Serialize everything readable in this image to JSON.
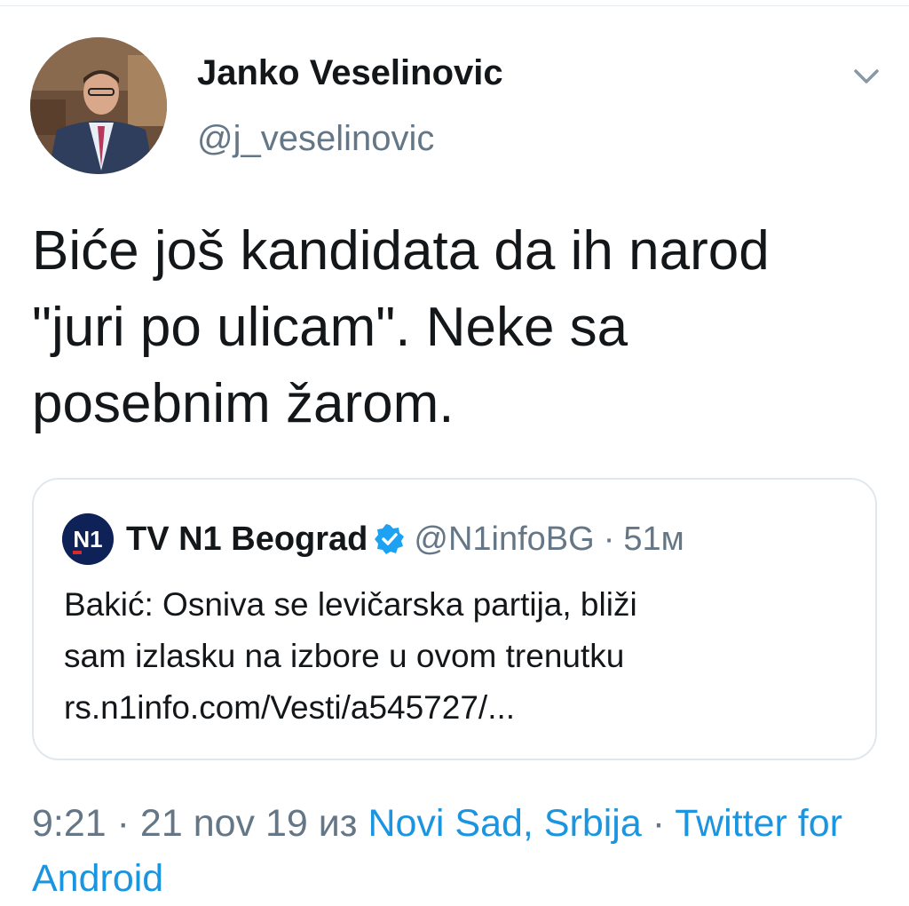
{
  "author": {
    "display_name": "Janko Veselinovic",
    "handle": "@j_veselinovic"
  },
  "tweet": {
    "text": "Biće još kandidata da ih narod\n\"juri po ulicam\". Neke sa\nposebnim žarom."
  },
  "quoted_tweet": {
    "logo_text": "N1",
    "name": "TV N1 Beograd",
    "handle": "@N1infoBG",
    "separator": "·",
    "time": "51м",
    "text_line1": "Bakić: Osniva se levičarska partija, bliži",
    "text_line2": "sam izlasku na izbore u ovom trenutku",
    "link": "rs.n1info.com/Vesti/a545727/..."
  },
  "meta": {
    "time": "9:21",
    "sep1": " · ",
    "date": "21 nov 19",
    "from_word": " из ",
    "location": "Novi Sad, Srbija",
    "sep2": " · ",
    "client": "Twitter for Android"
  },
  "colors": {
    "link": "#1b95e0",
    "secondary_text": "#657786",
    "primary_text": "#14171a",
    "verified": "#1da1f2",
    "border": "#e1e8ed"
  },
  "icons": [
    "chevron-down-icon",
    "verified-badge-icon"
  ]
}
